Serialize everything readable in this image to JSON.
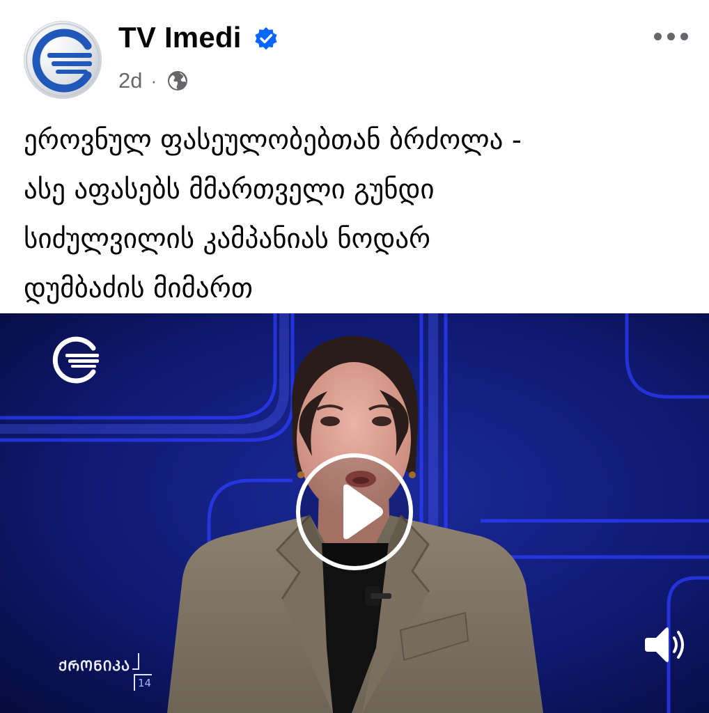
{
  "post": {
    "page_name": "TV Imedi",
    "verified": true,
    "time_ago": "2d",
    "separator": "·",
    "audience_icon": "globe-icon",
    "more_icon": "more-horizontal-icon"
  },
  "caption": {
    "lines": [
      "ეროვნულ ფასეულობებთან ბრძოლა -",
      "ასე აფასებს მმართველი გუნდი",
      "სიძულვილის კამპანიას ნოდარ",
      "დუმბაძის მიმართ"
    ]
  },
  "video": {
    "channel_logo_icon": "imedi-logo-icon",
    "play_icon": "play-icon",
    "sound_icon": "speaker-volume-icon",
    "show_name": "ᲥᲠᲝᲜᲘᲙᲐ",
    "show_number": "14"
  },
  "colors": {
    "verified_blue": "#0866ff",
    "secondary_text": "#65676b",
    "studio_background": "#0b1250",
    "studio_accent": "#2b3cff"
  }
}
